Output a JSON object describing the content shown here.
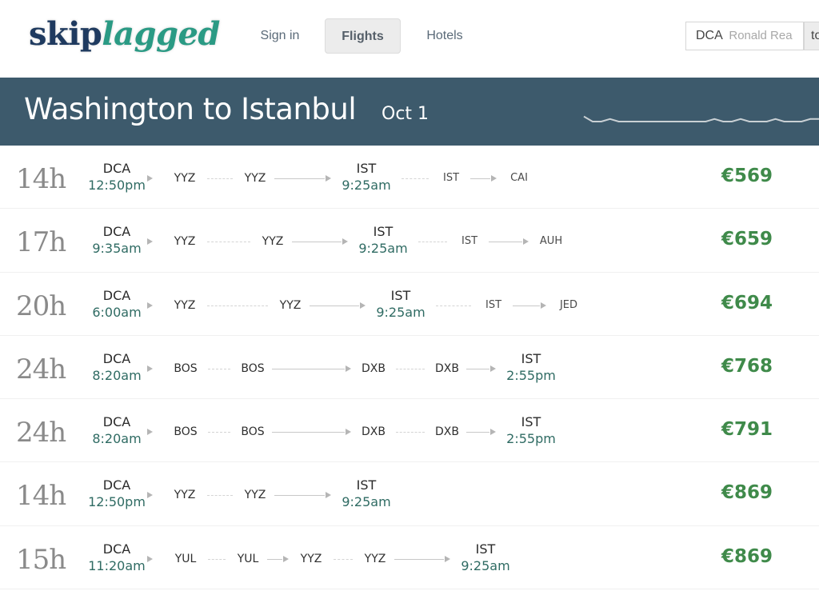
{
  "brand": {
    "logo_part1": "skip",
    "logo_part2": "lagged"
  },
  "nav": {
    "sign_in": "Sign in",
    "flights": "Flights",
    "hotels": "Hotels"
  },
  "search": {
    "origin_code": "DCA",
    "origin_name": "Ronald Rea",
    "to_label": "to"
  },
  "header": {
    "title": "Washington to Istanbul",
    "date": "Oct 1"
  },
  "price_trend": [
    3,
    1,
    1,
    2,
    1,
    1,
    1,
    1,
    1,
    1,
    1,
    1,
    1,
    1,
    1,
    2,
    1,
    1,
    2,
    1,
    1,
    1,
    2,
    1,
    1,
    1,
    2,
    2
  ],
  "colors": {
    "banner": "#3d5a6c",
    "price": "#3f8a4a",
    "time": "#2f6b63",
    "logo_dark": "#1f3a5f",
    "logo_teal": "#2a9a84"
  },
  "flights": [
    {
      "duration": "14h",
      "price": "€569",
      "stops": [
        {
          "code": "DCA",
          "time": "12:50pm",
          "kind": "major"
        },
        {
          "code": "YYZ",
          "kind": "minor"
        },
        {
          "code": "YYZ",
          "kind": "minor"
        },
        {
          "code": "IST",
          "time": "9:25am",
          "kind": "major"
        },
        {
          "code": "IST",
          "kind": "light"
        },
        {
          "code": "CAI",
          "kind": "light"
        }
      ]
    },
    {
      "duration": "17h",
      "price": "€659",
      "stops": [
        {
          "code": "DCA",
          "time": "9:35am",
          "kind": "major"
        },
        {
          "code": "YYZ",
          "kind": "minor"
        },
        {
          "code": "YYZ",
          "kind": "minor"
        },
        {
          "code": "IST",
          "time": "9:25am",
          "kind": "major"
        },
        {
          "code": "IST",
          "kind": "light"
        },
        {
          "code": "AUH",
          "kind": "light"
        }
      ]
    },
    {
      "duration": "20h",
      "price": "€694",
      "stops": [
        {
          "code": "DCA",
          "time": "6:00am",
          "kind": "major"
        },
        {
          "code": "YYZ",
          "kind": "minor"
        },
        {
          "code": "YYZ",
          "kind": "minor"
        },
        {
          "code": "IST",
          "time": "9:25am",
          "kind": "major"
        },
        {
          "code": "IST",
          "kind": "light"
        },
        {
          "code": "JED",
          "kind": "light"
        }
      ]
    },
    {
      "duration": "24h",
      "price": "€768",
      "stops": [
        {
          "code": "DCA",
          "time": "8:20am",
          "kind": "major"
        },
        {
          "code": "BOS",
          "kind": "minor"
        },
        {
          "code": "BOS",
          "kind": "minor"
        },
        {
          "code": "DXB",
          "kind": "minor"
        },
        {
          "code": "DXB",
          "kind": "minor"
        },
        {
          "code": "IST",
          "time": "2:55pm",
          "kind": "major"
        }
      ]
    },
    {
      "duration": "24h",
      "price": "€791",
      "stops": [
        {
          "code": "DCA",
          "time": "8:20am",
          "kind": "major"
        },
        {
          "code": "BOS",
          "kind": "minor"
        },
        {
          "code": "BOS",
          "kind": "minor"
        },
        {
          "code": "DXB",
          "kind": "minor"
        },
        {
          "code": "DXB",
          "kind": "minor"
        },
        {
          "code": "IST",
          "time": "2:55pm",
          "kind": "major"
        }
      ]
    },
    {
      "duration": "14h",
      "price": "€869",
      "stops": [
        {
          "code": "DCA",
          "time": "12:50pm",
          "kind": "major"
        },
        {
          "code": "YYZ",
          "kind": "minor"
        },
        {
          "code": "YYZ",
          "kind": "minor"
        },
        {
          "code": "IST",
          "time": "9:25am",
          "kind": "major"
        }
      ]
    },
    {
      "duration": "15h",
      "price": "€869",
      "stops": [
        {
          "code": "DCA",
          "time": "11:20am",
          "kind": "major"
        },
        {
          "code": "YUL",
          "kind": "minor"
        },
        {
          "code": "YUL",
          "kind": "minor"
        },
        {
          "code": "YYZ",
          "kind": "minor"
        },
        {
          "code": "YYZ",
          "kind": "minor"
        },
        {
          "code": "IST",
          "time": "9:25am",
          "kind": "major"
        }
      ]
    }
  ]
}
